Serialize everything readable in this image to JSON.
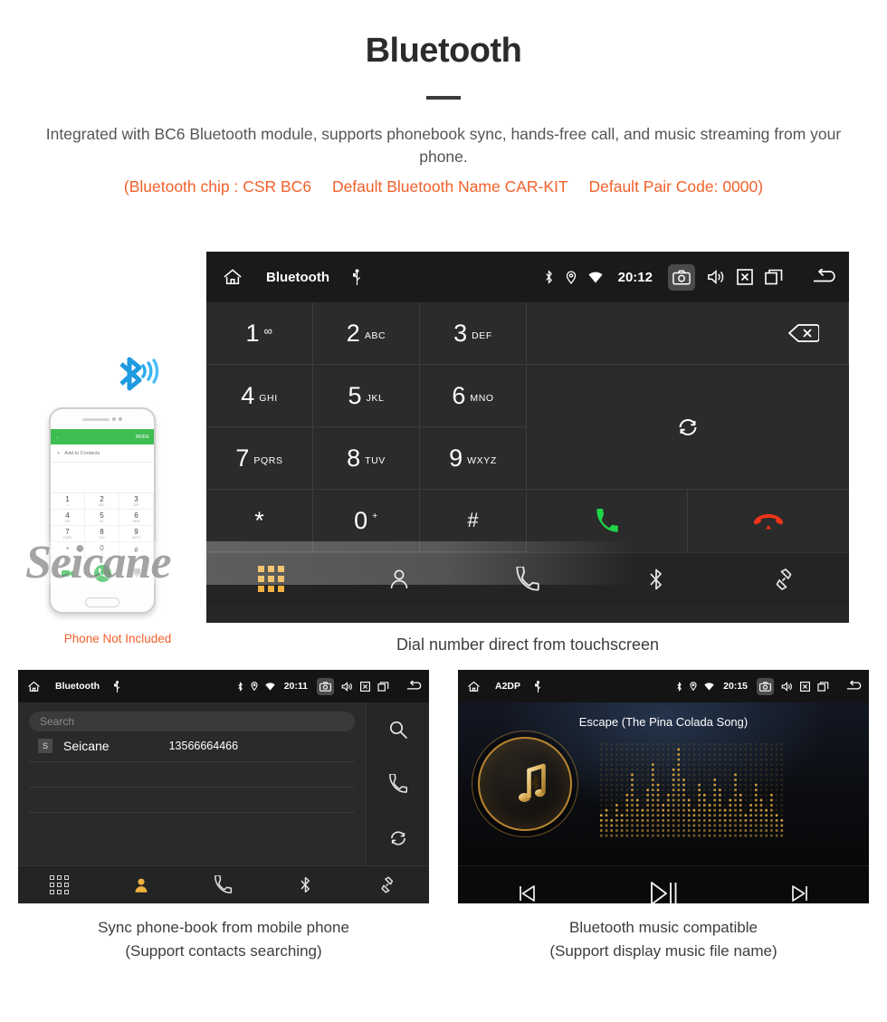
{
  "header": {
    "title": "Bluetooth",
    "intro": "Integrated with BC6 Bluetooth module, supports phonebook sync, hands-free call, and music streaming from your phone.",
    "spec_open": "(Bluetooth chip : CSR BC6",
    "spec_name": "Default Bluetooth Name CAR-KIT",
    "spec_code": "Default Pair Code: 0000)",
    "accent_color": "#f2612b",
    "title_color": "#2b2b2b"
  },
  "watermark": {
    "text": "Seicane"
  },
  "phone_illustration": {
    "note": "Phone Not Included",
    "bt_icon": "bluetooth-signal-icon",
    "screen": {
      "more_label": "MORE",
      "add_label": "Add to Contacts",
      "keys": [
        {
          "num": "1",
          "sub": "∞"
        },
        {
          "num": "2",
          "sub": "ABC"
        },
        {
          "num": "3",
          "sub": "DEF"
        },
        {
          "num": "4",
          "sub": "GHI"
        },
        {
          "num": "5",
          "sub": "JKL"
        },
        {
          "num": "6",
          "sub": "MNO"
        },
        {
          "num": "7",
          "sub": "PQRS"
        },
        {
          "num": "8",
          "sub": "TUV"
        },
        {
          "num": "9",
          "sub": "WXYZ"
        },
        {
          "num": "*",
          "sub": ""
        },
        {
          "num": "0",
          "sub": "+"
        },
        {
          "num": "#",
          "sub": ""
        }
      ]
    }
  },
  "dialer": {
    "statusbar": {
      "home_icon": "home-icon",
      "title": "Bluetooth",
      "usb_icon": "usb-icon",
      "bluetooth_icon": "bluetooth-icon",
      "location_icon": "location-pin-icon",
      "wifi_icon": "wifi-icon",
      "clock": "20:12",
      "camera_icon": "camera-icon",
      "volume_icon": "volume-icon",
      "close_icon": "close-box-icon",
      "recents_icon": "recent-apps-icon",
      "back_icon": "back-arrow-icon"
    },
    "keys": [
      {
        "num": "1",
        "sub": "∞"
      },
      {
        "num": "2",
        "sub": "ABC"
      },
      {
        "num": "3",
        "sub": "DEF"
      },
      {
        "num": "4",
        "sub": "GHI"
      },
      {
        "num": "5",
        "sub": "JKL"
      },
      {
        "num": "6",
        "sub": "MNO"
      },
      {
        "num": "7",
        "sub": "PQRS"
      },
      {
        "num": "8",
        "sub": "TUV"
      },
      {
        "num": "9",
        "sub": "WXYZ"
      },
      {
        "num": "*",
        "sub": ""
      },
      {
        "num": "0",
        "sub": "+"
      },
      {
        "num": "#",
        "sub": ""
      }
    ],
    "backspace_icon": "backspace-icon",
    "sync_icon": "sync-icon",
    "call_icon": "call-green-icon",
    "hangup_icon": "hangup-red-icon",
    "call_color": "#1fd64a",
    "hangup_color": "#f03418",
    "nav": [
      {
        "icon": "dialpad-icon",
        "active": true
      },
      {
        "icon": "contacts-icon",
        "active": false
      },
      {
        "icon": "call-log-icon",
        "active": false
      },
      {
        "icon": "bluetooth-icon",
        "active": false
      },
      {
        "icon": "link-icon",
        "active": false
      }
    ],
    "active_color": "#f0b040",
    "caption": "Dial number direct from touchscreen"
  },
  "phonebook": {
    "statusbar": {
      "title": "Bluetooth",
      "clock": "20:11"
    },
    "search_placeholder": "Search",
    "contacts": [
      {
        "initial": "S",
        "name": "Seicane",
        "number": "13566664466"
      }
    ],
    "side_actions": [
      {
        "icon": "search-icon"
      },
      {
        "icon": "call-icon"
      },
      {
        "icon": "sync-icon"
      }
    ],
    "nav": [
      {
        "icon": "dialpad-icon",
        "active": false
      },
      {
        "icon": "contacts-icon",
        "active": true
      },
      {
        "icon": "call-log-icon",
        "active": false
      },
      {
        "icon": "bluetooth-icon",
        "active": false
      },
      {
        "icon": "link-icon",
        "active": false
      }
    ],
    "caption_line1": "Sync phone-book from mobile phone",
    "caption_line2": "(Support contacts searching)"
  },
  "music": {
    "statusbar": {
      "title": "A2DP",
      "clock": "20:15"
    },
    "song_title": "Escape (The Pina Colada Song)",
    "album_icon": "music-note-bluetooth-icon",
    "equalizer": "dot-matrix-equalizer",
    "controls": [
      {
        "icon": "previous-track-icon"
      },
      {
        "icon": "play-pause-icon"
      },
      {
        "icon": "next-track-icon"
      }
    ],
    "accent_color": "#c8932f",
    "caption_line1": "Bluetooth music compatible",
    "caption_line2": "(Support display music file name)"
  }
}
